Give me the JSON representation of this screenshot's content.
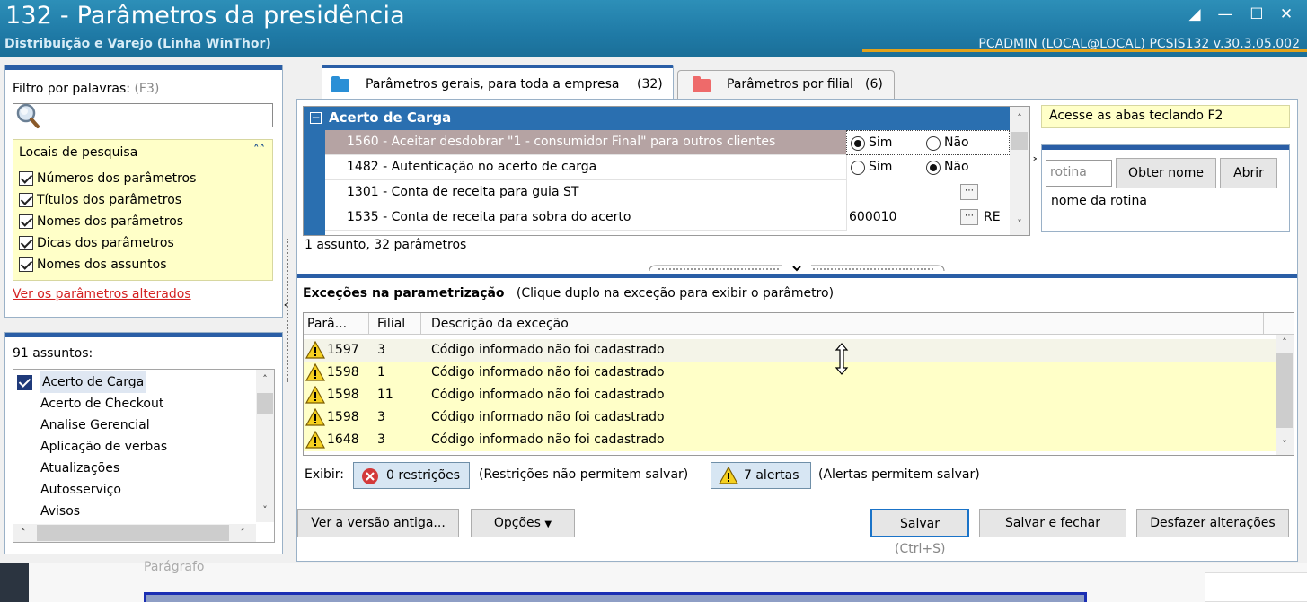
{
  "window": {
    "title": "132 - Parâmetros da presidência",
    "subtitle": "Distribuição e Varejo (Linha WinThor)",
    "user_info": "PCADMIN (LOCAL@LOCAL)   PCSIS132  v.30.3.05.002"
  },
  "filter": {
    "label": "Filtro por palavras:",
    "shortcut": "(F3)",
    "search_value": "",
    "locais_title": "Locais de pesquisa",
    "options": [
      "Números dos parâmetros",
      "Títulos dos parâmetros",
      "Nomes dos parâmetros",
      "Dicas dos parâmetros",
      "Nomes dos assuntos"
    ],
    "ver_alterados": "Ver os parâmetros alterados"
  },
  "assuntos": {
    "count_label": "91 assuntos:",
    "items": [
      "Acerto de Carga",
      "Acerto de Checkout",
      "Analise Gerencial",
      "Aplicação de verbas",
      "Atualizações",
      "Autosserviço",
      "Avisos"
    ]
  },
  "tabs": [
    {
      "label": "Parâmetros gerais, para toda a empresa",
      "count": "(32)"
    },
    {
      "label": "Parâmetros por filial",
      "count": "(6)"
    }
  ],
  "params": {
    "group": "Acerto de Carga",
    "rows": [
      {
        "text": "1560 - Aceitar desdobrar \"1 - consumidor Final\" para outros clientes",
        "yes": "Sim",
        "no": "Não",
        "value": ""
      },
      {
        "text": "1482 - Autenticação no acerto de carga",
        "yes": "Sim",
        "no": "Não",
        "value": ""
      },
      {
        "text": "1301 - Conta de receita para guia ST",
        "yes": "",
        "no": "",
        "value": ""
      },
      {
        "text": "1535 - Conta de receita para sobra do acerto",
        "yes": "",
        "no": "",
        "value": "600010",
        "suffix": "RE"
      }
    ],
    "summary": "1 assunto, 32 parâmetros"
  },
  "side": {
    "hint": "Acesse as abas teclando F2",
    "rotina_placeholder": "rotina",
    "btn_obter": "Obter nome",
    "btn_abrir": "Abrir",
    "rotina_name": "nome da rotina"
  },
  "exceptions": {
    "title": "Exceções na parametrização",
    "subtitle": "(Clique duplo na exceção para exibir o parâmetro)",
    "columns": [
      "Parâ...",
      "Filial",
      "Descrição da exceção"
    ],
    "rows": [
      {
        "param": "1597",
        "filial": "3",
        "desc": "Código informado não foi cadastrado"
      },
      {
        "param": "1598",
        "filial": "1",
        "desc": "Código informado não foi cadastrado"
      },
      {
        "param": "1598",
        "filial": "11",
        "desc": "Código informado não foi cadastrado"
      },
      {
        "param": "1598",
        "filial": "3",
        "desc": "Código informado não foi cadastrado"
      },
      {
        "param": "1648",
        "filial": "3",
        "desc": "Código informado não foi cadastrado"
      }
    ],
    "exibir": "Exibir:",
    "restricoes": "0 restrições",
    "restricoes_note": "(Restrições não permitem salvar)",
    "alertas": "7 alertas",
    "alertas_note": "(Alertas permitem salvar)"
  },
  "buttons": {
    "versao": "Ver a versão antiga...",
    "opcoes": "Opções",
    "salvar": "Salvar",
    "salvar_shortcut": "(Ctrl+S)",
    "salvar_fechar": "Salvar e fechar",
    "desfazer": "Desfazer alterações"
  },
  "background": {
    "ghost_text": "Parágrafo"
  },
  "colors": {
    "title_bar": "#1f7aa6",
    "accent_blue": "#2a5ea6",
    "yellow_bg": "#ffffc8",
    "link_red": "#d42222",
    "selected_row": "#b5a3a3"
  }
}
